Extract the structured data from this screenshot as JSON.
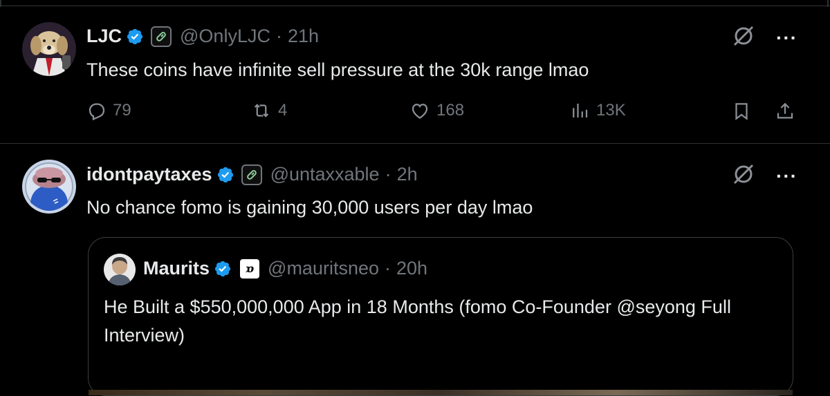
{
  "tweets": [
    {
      "author": "LJC",
      "handle": "@OnlyLJC",
      "separator": "·",
      "time": "21h",
      "text": "These coins have infinite sell pressure at the 30k range lmao",
      "replies": "79",
      "reposts": "4",
      "likes": "168",
      "views": "13K"
    },
    {
      "author": "idontpaytaxes",
      "handle": "@untaxxable",
      "separator": "·",
      "time": "2h",
      "text": "No chance fomo is gaining 30,000 users per day lmao",
      "quote": {
        "author": "Maurits",
        "affiliate_badge": "ɒ",
        "handle": "@mauritsneo",
        "separator": "·",
        "time": "20h",
        "text": "He Built a $550,000,000 App in 18 Months (fomo Co-Founder @seyong Full Interview)"
      }
    }
  ],
  "icons": {
    "more": "···",
    "grok": "grok-icon",
    "reply": "reply-icon",
    "repost": "repost-icon",
    "like": "heart-icon",
    "views": "views-icon",
    "bookmark": "bookmark-icon",
    "share": "share-icon"
  },
  "colors": {
    "background": "#000000",
    "text": "#e7e9ea",
    "muted": "#71767b",
    "verified": "#1d9bf0",
    "divider": "#2f3336"
  }
}
